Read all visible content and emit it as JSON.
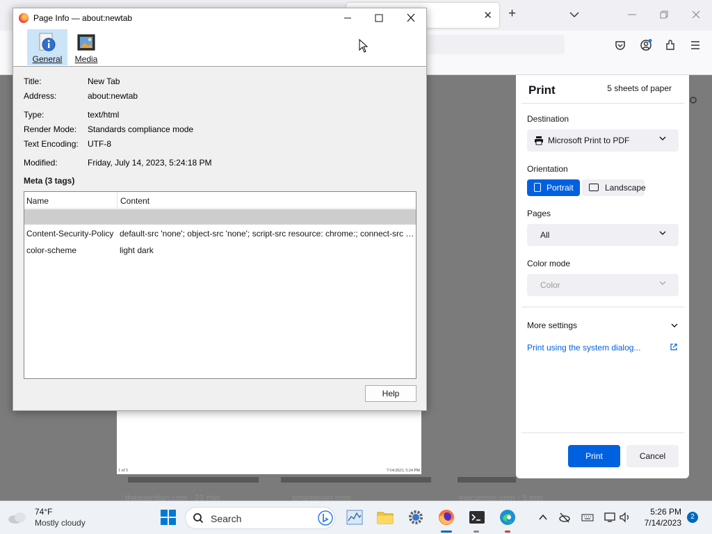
{
  "browser": {
    "tab_close": "✕",
    "new_tab": "+"
  },
  "preview": {
    "footer_left": "1 of 5",
    "footer_right": "7/14/2023, 5:24 PM"
  },
  "cards": [
    {
      "label": "theguardian.com · 21 min"
    },
    {
      "label": "smartasset.com"
    },
    {
      "label": "epicurious.com · 5 min"
    }
  ],
  "print_panel": {
    "title": "Print",
    "sheets": "5 sheets of paper",
    "destination_label": "Destination",
    "destination_value": "Microsoft Print to PDF",
    "orientation_label": "Orientation",
    "portrait": "Portrait",
    "landscape": "Landscape",
    "orientation_selected": "Portrait",
    "pages_label": "Pages",
    "pages_value": "All",
    "color_mode_label": "Color mode",
    "color_mode_value": "Color",
    "more_settings": "More settings",
    "system_dialog_link": "Print using the system dialog...",
    "print_button": "Print",
    "cancel_button": "Cancel",
    "accent_color": "#0061e0"
  },
  "page_info": {
    "window_title": "Page Info — about:newtab",
    "tabs": [
      {
        "label": "General",
        "icon": "info-icon",
        "selected": true
      },
      {
        "label": "Media",
        "icon": "media-icon",
        "selected": false
      }
    ],
    "fields": {
      "title_label": "Title:",
      "title_value": "New Tab",
      "address_label": "Address:",
      "address_value": "about:newtab",
      "type_label": "Type:",
      "type_value": "text/html",
      "render_label": "Render Mode:",
      "render_value": "Standards compliance mode",
      "encoding_label": "Text Encoding:",
      "encoding_value": "UTF-8",
      "modified_label": "Modified:",
      "modified_value": "Friday, July 14, 2023, 5:24:18 PM"
    },
    "meta_heading": "Meta (3 tags)",
    "meta_columns": [
      "Name",
      "Content"
    ],
    "meta_rows": [
      {
        "name": "",
        "content": ""
      },
      {
        "name": "Content-Security-Policy",
        "content": "default-src 'none'; object-src 'none'; script-src resource: chrome:; connect-src https:; img-src https: data: blob:"
      },
      {
        "name": "color-scheme",
        "content": "light dark"
      }
    ],
    "help_button": "Help"
  },
  "taskbar": {
    "weather_temp": "74°F",
    "weather_desc": "Mostly cloudy",
    "search_placeholder": "Search",
    "time": "5:26 PM",
    "date": "7/14/2023",
    "notifications": "2"
  }
}
